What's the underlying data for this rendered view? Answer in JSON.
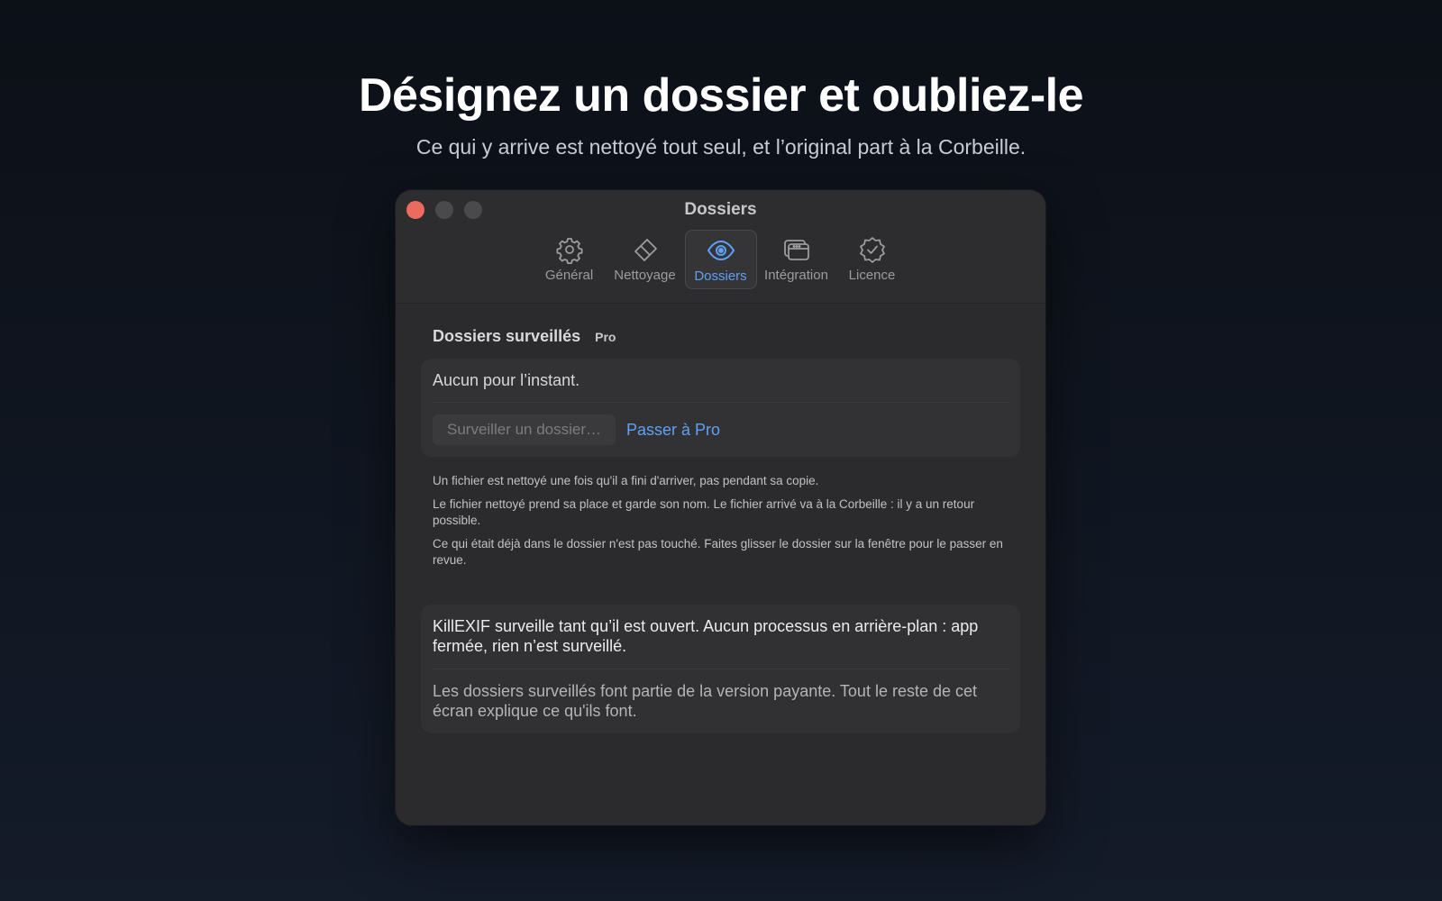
{
  "hero": {
    "title": "Désignez un dossier et oubliez-le",
    "subtitle": "Ce qui y arrive est nettoyé tout seul, et l’original part à la Corbeille."
  },
  "window": {
    "title": "Dossiers",
    "tabs": [
      {
        "label": "Général",
        "icon": "gear-icon",
        "active": false
      },
      {
        "label": "Nettoyage",
        "icon": "eraser-icon",
        "active": false
      },
      {
        "label": "Dossiers",
        "icon": "eye-icon",
        "active": true
      },
      {
        "label": "Intégration",
        "icon": "windows-icon",
        "active": false
      },
      {
        "label": "Licence",
        "icon": "checkmark-seal-icon",
        "active": false
      }
    ]
  },
  "watched": {
    "title": "Dossiers surveillés",
    "badge": "Pro",
    "empty_text": "Aucun pour l’instant.",
    "watch_button": "Surveiller un dossier…",
    "upgrade_link": "Passer à Pro"
  },
  "notes": [
    "Un fichier est nettoyé une fois qu'il a fini d'arriver, pas pendant sa copie.",
    "Le fichier nettoyé prend sa place et garde son nom. Le fichier arrivé va à la Corbeille : il y a un retour possible.",
    "Ce qui était déjà dans le dossier n'est pas touché. Faites glisser le dossier sur la fenêtre pour le passer en revue."
  ],
  "info": {
    "line1": "KillEXIF surveille tant qu’il est ouvert. Aucun processus en arrière-plan : app fermée, rien n’est surveillé.",
    "line2": "Les dossiers surveillés font partie de la version payante. Tout le reste de cet écran explique ce qu'ils font."
  },
  "colors": {
    "accent": "#5ea0f5",
    "close_light": "#ed6a5e",
    "window_bg": "#2b2b2d"
  }
}
